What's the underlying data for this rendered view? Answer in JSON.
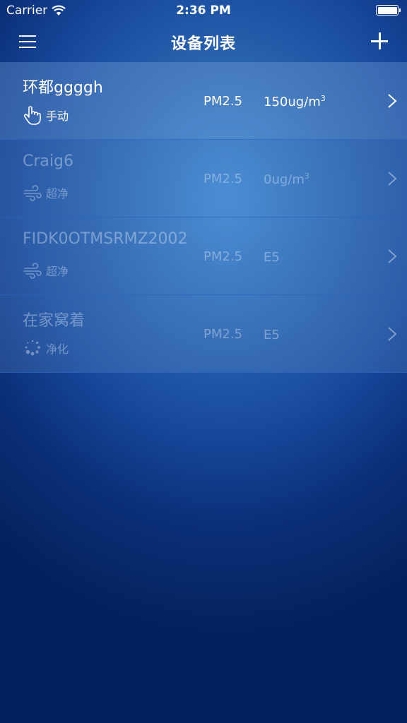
{
  "status_bar": {
    "carrier": "Carrier",
    "time": "2:36 PM",
    "battery_level": 1.0
  },
  "nav_bar": {
    "title": "设备列表",
    "left_icon": "menu-icon",
    "right_icon": "add-icon"
  },
  "devices": [
    {
      "name": "环都ggggh",
      "mode_icon": "hand-icon",
      "mode": "手动",
      "pm_label": "PM2.5",
      "pm_value": "150ug/m",
      "pm_sup": "3",
      "online": true
    },
    {
      "name": "Craig6",
      "mode_icon": "wind-icon",
      "mode": "超净",
      "pm_label": "PM2.5",
      "pm_value": "0ug/m",
      "pm_sup": "3",
      "online": false
    },
    {
      "name": "FIDK0OTMSRMZ2002",
      "mode_icon": "wind-icon",
      "mode": "超净",
      "pm_label": "PM2.5",
      "pm_value": "E5",
      "pm_sup": "",
      "online": false
    },
    {
      "name": "在家窝着",
      "mode_icon": "purify-icon",
      "mode": "净化",
      "pm_label": "PM2.5",
      "pm_value": "E5",
      "pm_sup": "",
      "online": false
    }
  ]
}
